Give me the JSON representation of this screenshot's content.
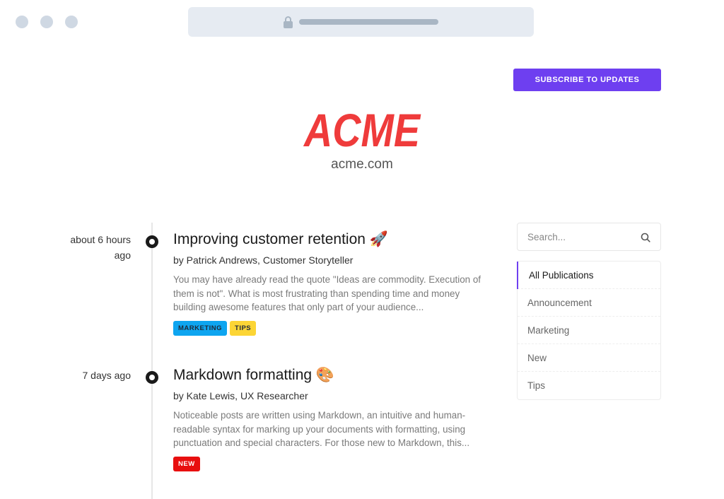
{
  "browser": {
    "window_controls": [
      "close",
      "minimize",
      "maximize"
    ],
    "address_icon": "lock-icon"
  },
  "header": {
    "subscribe_label": "SUBSCRIBE TO UPDATES",
    "logo_text": "ACME",
    "domain": "acme.com",
    "colors": {
      "accent": "#6e3ff0",
      "logo": "#ef3b3b"
    }
  },
  "posts": [
    {
      "time": "about 6 hours ago",
      "title": "Improving customer retention",
      "emoji": "🚀",
      "author": "by Patrick Andrews, Customer Storyteller",
      "excerpt": "You may have already read the quote \"Ideas are commodity. Execution of them is not\". What is most frustrating than spending time and money building awesome features that only part of your audience...",
      "tags": [
        {
          "label": "MARKETING",
          "bg": "#0ea5f0",
          "color": "#1f2937"
        },
        {
          "label": "TIPS",
          "bg": "#fcd535",
          "color": "#1f2937"
        }
      ]
    },
    {
      "time": "7 days ago",
      "title": "Markdown formatting",
      "emoji": "🎨",
      "author": "by Kate Lewis, UX Researcher",
      "excerpt": "Noticeable posts are written using Markdown, an intuitive and human-readable syntax for marking up your documents with formatting, using punctuation and special characters. For those new to Markdown, this...",
      "tags": [
        {
          "label": "NEW",
          "bg": "#e80f0f",
          "color": "#ffffff"
        }
      ]
    }
  ],
  "sidebar": {
    "search_placeholder": "Search...",
    "categories": [
      {
        "label": "All Publications",
        "active": true
      },
      {
        "label": "Announcement",
        "active": false
      },
      {
        "label": "Marketing",
        "active": false
      },
      {
        "label": "New",
        "active": false
      },
      {
        "label": "Tips",
        "active": false
      }
    ]
  }
}
